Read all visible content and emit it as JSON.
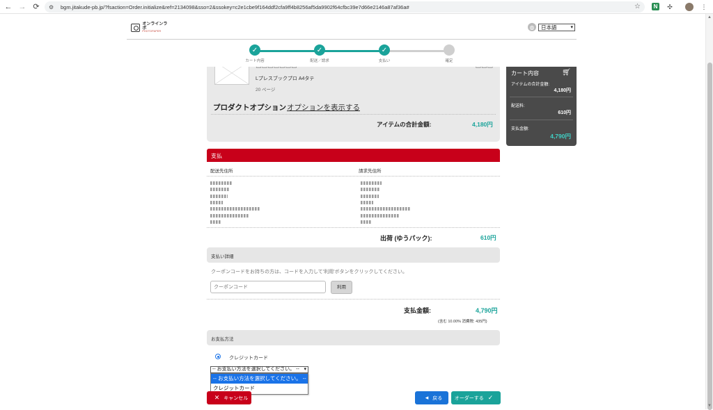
{
  "browser": {
    "url": "bgm.jitakude-pb.jp/?fsaction=Order.initialize&ref=2134098&sso=2&ssokey=c2e1cbe9f164ddf2cfa9ff4b8256af5da9902f64cfbc39e7d66e2146a87af36a#",
    "ext_n_label": "N"
  },
  "header": {
    "logo_line1": "オンラインラボ",
    "logo_line2": "PHOTOPAPER",
    "language": "日本語"
  },
  "steps": [
    {
      "label": "カート内容",
      "state": "done"
    },
    {
      "label": "配送／請求",
      "state": "done"
    },
    {
      "label": "支払い",
      "state": "done"
    },
    {
      "label": "確定",
      "state": "todo"
    }
  ],
  "cart": {
    "product": "Lプレスブックプロ A4タテ",
    "pages": "20 ページ",
    "options_label": "プロダクトオプション",
    "options_link": "オプションを表示する",
    "items_total_label": "アイテムの合計金額:",
    "items_total_value": "4,180円"
  },
  "summary": {
    "title": "カート内容",
    "items_label": "アイテムの合計金額:",
    "items_value": "4,180円",
    "shipping_label": "配送料:",
    "shipping_value": "610円",
    "payment_label": "支払金額:",
    "payment_value": "4,790円"
  },
  "payment": {
    "header": "支払",
    "ship_addr_label": "配送先住所",
    "bill_addr_label": "請求先住所",
    "shipping_label": "出荷 (ゆうパック):",
    "shipping_value": "610円",
    "details_header": "支払い詳細",
    "coupon_note": "クーポンコードをお持ちの方は、コードを入力して'利用'ボタンをクリックしてください。",
    "coupon_placeholder": "クーポンコード",
    "coupon_button": "利用",
    "total_label": "支払金額:",
    "total_value": "4,790円",
    "tax_note": "(含む 10.00% 消費税: 435円)",
    "method_header": "お支払方法",
    "method_radio_label": "クレジットカード",
    "method_select_value": "-- お支払い方法を選択してください。 --",
    "method_options": [
      "-- お支払い方法を選択してください。 --",
      "クレジットカード"
    ]
  },
  "actions": {
    "cancel": "キャンセル",
    "back": "戻る",
    "order": "オーダーする"
  },
  "colors": {
    "teal": "#1aa39a",
    "red": "#c8001a",
    "blue": "#1a73d8",
    "summary_bg": "#4a4a4a"
  }
}
